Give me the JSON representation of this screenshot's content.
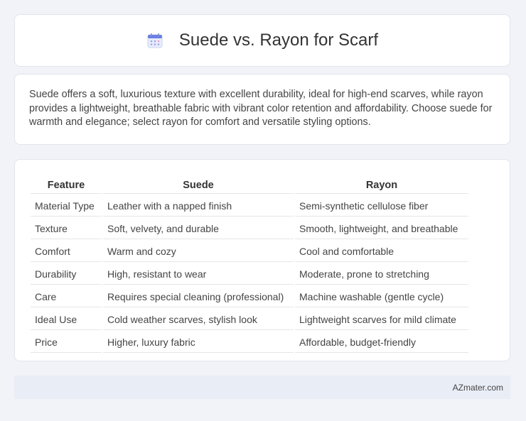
{
  "header": {
    "icon": "calendar-icon",
    "title": "Suede vs. Rayon for Scarf"
  },
  "intro": {
    "text": "Suede offers a soft, luxurious texture with excellent durability, ideal for high-end scarves, while rayon provides a lightweight, breathable fabric with vibrant color retention and affordability. Choose suede for warmth and elegance; select rayon for comfort and versatile styling options."
  },
  "table": {
    "headers": [
      "Feature",
      "Suede",
      "Rayon"
    ],
    "rows": [
      [
        "Material Type",
        "Leather with a napped finish",
        "Semi-synthetic cellulose fiber"
      ],
      [
        "Texture",
        "Soft, velvety, and durable",
        "Smooth, lightweight, and breathable"
      ],
      [
        "Comfort",
        "Warm and cozy",
        "Cool and comfortable"
      ],
      [
        "Durability",
        "High, resistant to wear",
        "Moderate, prone to stretching"
      ],
      [
        "Care",
        "Requires special cleaning (professional)",
        "Machine washable (gentle cycle)"
      ],
      [
        "Ideal Use",
        "Cold weather scarves, stylish look",
        "Lightweight scarves for mild climate"
      ],
      [
        "Price",
        "Higher, luxury fabric",
        "Affordable, budget-friendly"
      ]
    ]
  },
  "footer": {
    "brand": "AZmater.com"
  },
  "colors": {
    "background": "#f1f3f8",
    "card": "#ffffff",
    "footer": "#e9edf6",
    "icon_accent": "#5b6ee1"
  }
}
